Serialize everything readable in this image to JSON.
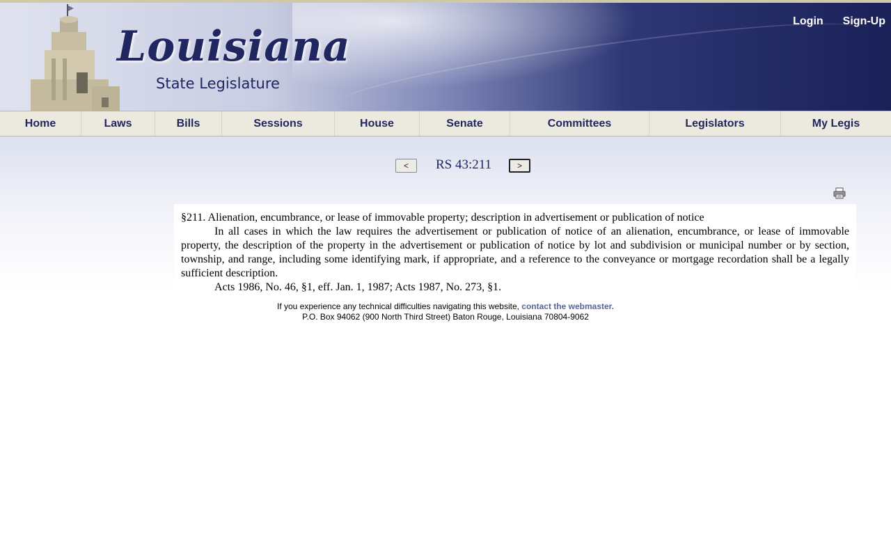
{
  "header": {
    "logo_title": "Louisiana",
    "logo_subtitle": "State Legislature",
    "login": "Login",
    "signup": "Sign-Up"
  },
  "nav": {
    "items": [
      {
        "label": "Home"
      },
      {
        "label": "Laws"
      },
      {
        "label": "Bills"
      },
      {
        "label": "Sessions"
      },
      {
        "label": "House"
      },
      {
        "label": "Senate"
      },
      {
        "label": "Committees"
      },
      {
        "label": "Legislators"
      },
      {
        "label": "My Legis"
      }
    ]
  },
  "pager": {
    "prev_label": "<",
    "title": "RS 43:211",
    "next_label": ">"
  },
  "law": {
    "heading": "§211.  Alienation, encumbrance, or lease of immovable property; description in advertisement or publication of notice",
    "body": "In all cases in which the law requires the advertisement or publication of notice of an alienation, encumbrance, or lease of immovable property, the description of the property in the advertisement or publication of notice by lot and subdivision or municipal number or by section, township, and range, including some identifying mark, if appropriate, and a reference to the conveyance or mortgage recordation shall be a legally sufficient description.",
    "history": "Acts 1986, No. 46, §1, eff. Jan. 1, 1987; Acts 1987, No. 273, §1."
  },
  "footer": {
    "line1_text": "If you experience any technical difficulties navigating this website, ",
    "line1_link": "contact the webmaster.",
    "line2": "P.O. Box 94062 (900 North Third Street) Baton Rouge, Louisiana 70804-9062"
  },
  "colors": {
    "brand_navy": "#1f2660",
    "nav_bg": "#eceadf",
    "link": "#5a6494"
  },
  "icons": {
    "print": "printer-icon"
  }
}
